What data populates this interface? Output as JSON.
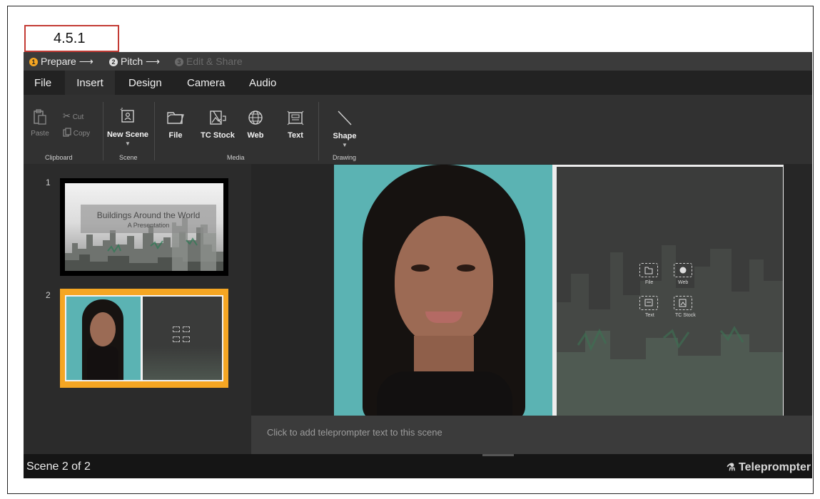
{
  "figure_label": "4.5.1",
  "steps": [
    {
      "num": "1",
      "label": "Prepare ⟶",
      "state": "active"
    },
    {
      "num": "2",
      "label": "Pitch ⟶",
      "state": "normal"
    },
    {
      "num": "3",
      "label": "Edit & Share",
      "state": "disabled"
    }
  ],
  "menu": {
    "file": "File",
    "insert": "Insert",
    "design": "Design",
    "camera": "Camera",
    "audio": "Audio",
    "active": "Insert"
  },
  "ribbon": {
    "clipboard": {
      "paste": "Paste",
      "cut": "Cut",
      "copy": "Copy",
      "group": "Clipboard"
    },
    "scene": {
      "new_scene": "New Scene",
      "group": "Scene"
    },
    "media": {
      "file": "File",
      "tc_stock": "TC Stock",
      "web": "Web",
      "text": "Text",
      "group": "Media"
    },
    "drawing": {
      "shape": "Shape",
      "group": "Drawing"
    }
  },
  "scenes": [
    {
      "number": "1",
      "title": "Buildings Around the World",
      "subtitle": "A Presentation",
      "selected": false
    },
    {
      "number": "2",
      "selected": true
    }
  ],
  "placeholders": {
    "file": "File",
    "web": "Web",
    "text": "Text",
    "tc_stock": "TC Stock"
  },
  "teleprompter_placeholder": "Click to add teleprompter text to this scene",
  "status": {
    "scene_count": "Scene 2 of 2",
    "teleprompter": "Teleprompter"
  },
  "colors": {
    "accent": "#f5a623",
    "app_bg": "#2b2b2b",
    "backdrop": "#5bb3b3",
    "label_border": "#c33b34"
  }
}
